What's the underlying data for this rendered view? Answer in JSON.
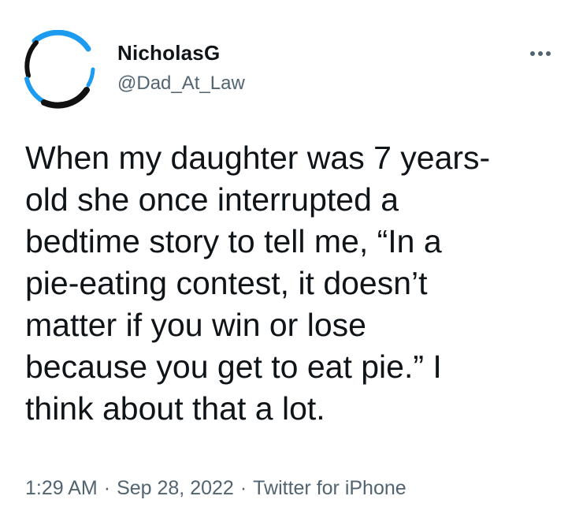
{
  "tweet": {
    "author": {
      "display_name": "NicholasG",
      "handle": "@Dad_At_Law",
      "avatar_icon": "profile-avatar"
    },
    "more_icon": "more-horizontal-icon",
    "text": "When my daughter was 7 years-\nold she once interrupted a\nbedtime story to tell me, “In a\npie-eating contest, it doesn’t\nmatter if you win or lose\nbecause you get to eat pie.” I\nthink about that a lot.",
    "time": "1:29 AM",
    "date": "Sep 28, 2022",
    "source": "Twitter for iPhone",
    "separator": "·",
    "colors": {
      "text": "#0f1419",
      "secondary": "#536471",
      "avatar_ring": "#1d9bf0"
    }
  }
}
